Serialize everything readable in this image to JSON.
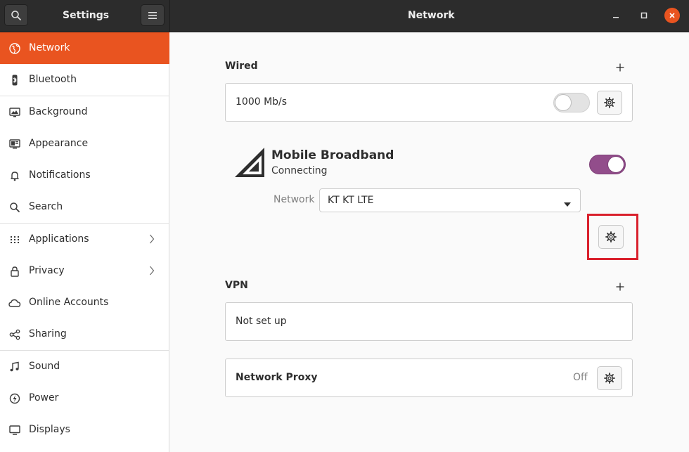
{
  "header": {
    "app_title": "Settings",
    "page_title": "Network",
    "search_icon": "search-icon",
    "menu_icon": "hamburger-menu-icon",
    "window_controls": [
      "minimize-icon",
      "maximize-icon",
      "close-icon"
    ]
  },
  "sidebar": {
    "items": [
      {
        "label": "Network",
        "icon": "network-icon",
        "active": true
      },
      {
        "label": "Bluetooth",
        "icon": "bluetooth-icon"
      },
      {
        "label": "Background",
        "icon": "background-icon"
      },
      {
        "label": "Appearance",
        "icon": "appearance-icon"
      },
      {
        "label": "Notifications",
        "icon": "bell-icon"
      },
      {
        "label": "Search",
        "icon": "search-icon"
      },
      {
        "label": "Applications",
        "icon": "grid-icon",
        "has_submenu": true
      },
      {
        "label": "Privacy",
        "icon": "lock-icon",
        "has_submenu": true
      },
      {
        "label": "Online Accounts",
        "icon": "cloud-icon"
      },
      {
        "label": "Sharing",
        "icon": "share-icon"
      },
      {
        "label": "Sound",
        "icon": "music-note-icon"
      },
      {
        "label": "Power",
        "icon": "power-icon"
      },
      {
        "label": "Displays",
        "icon": "display-icon"
      }
    ]
  },
  "wired": {
    "title": "Wired",
    "add_icon": "plus-icon",
    "connection": {
      "speed": "1000 Mb/s",
      "enabled": false
    }
  },
  "mobile": {
    "title": "Mobile Broadband",
    "status": "Connecting",
    "enabled": true,
    "network_label": "Network",
    "network_value": "KT KT LTE"
  },
  "vpn": {
    "title": "VPN",
    "add_icon": "plus-icon",
    "empty_text": "Not set up"
  },
  "proxy": {
    "title": "Network Proxy",
    "status": "Off"
  },
  "colors": {
    "accent": "#e95420",
    "switch_on": "#924d8b",
    "highlight": "#d9202c"
  }
}
